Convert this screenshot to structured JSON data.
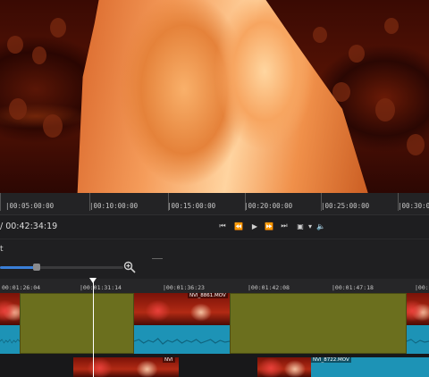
{
  "ruler": {
    "labels": [
      "|00:05:00:00",
      "|00:10:00:00",
      "|00:15:00:00",
      "|00:20:00:00",
      "|00:25:00:00",
      "|00:30:0"
    ]
  },
  "transport": {
    "timecode": "/ 00:42:34:19",
    "buttons": {
      "skip_start": "⏮",
      "rewind": "⏪",
      "play": "▶",
      "fast_forward": "⏩",
      "skip_end": "⏭",
      "fullscreen": "▣",
      "dropdown": "▾",
      "volume": "🔈"
    }
  },
  "toolbar": {
    "label": "t",
    "zoom_level": 0.3
  },
  "timeline": {
    "labels": [
      "00:01:26:04",
      "|00:01:31:14",
      "|00:01:36:23",
      "|00:01:42:08",
      "|00:01:47:18",
      "|00:0"
    ],
    "clip_names": [
      "NVI_8861.MOV",
      "NVI",
      "NVI_8722.MOV"
    ]
  },
  "colors": {
    "accent": "#3a7fd8",
    "audio_clip": "#1d93b6",
    "transition_clip": "#6b6f1e",
    "playhead": "#ffffff"
  }
}
